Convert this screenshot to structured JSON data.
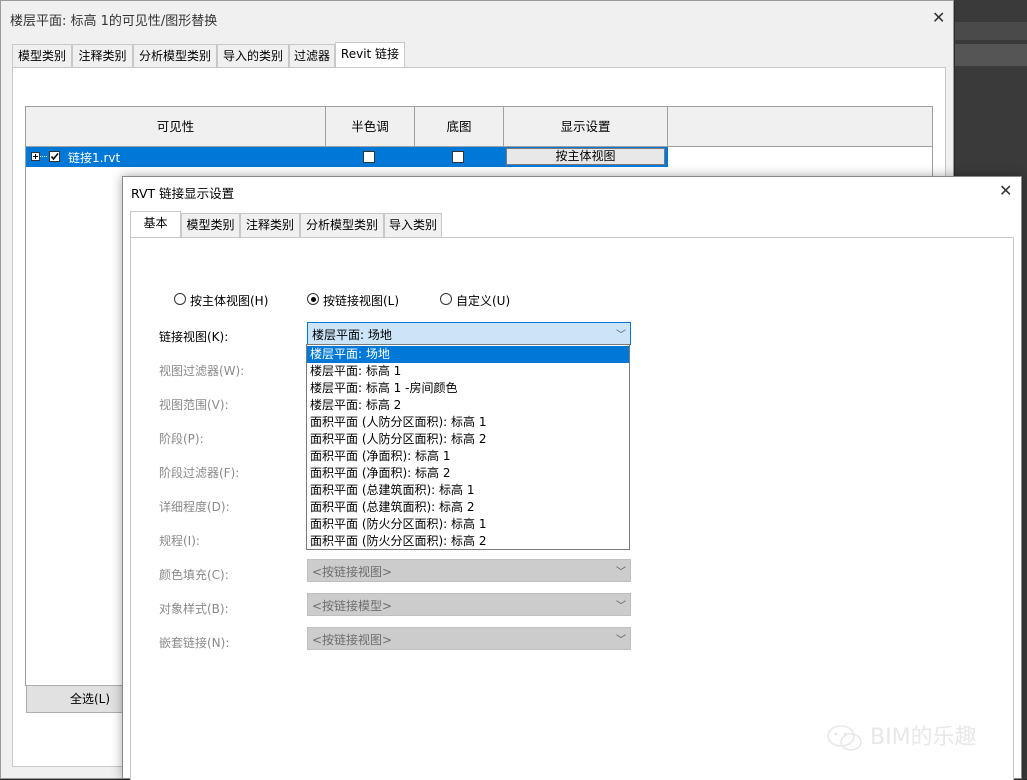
{
  "main_dialog": {
    "title": "楼层平面: 标高 1的可见性/图形替换",
    "tabs": [
      "模型类别",
      "注释类别",
      "分析模型类别",
      "导入的类别",
      "过滤器",
      "Revit 链接"
    ],
    "active_tab": "Revit 链接",
    "columns": [
      "可见性",
      "半色调",
      "底图",
      "显示设置"
    ],
    "rows": [
      {
        "name": "链接1.rvt",
        "visible": true,
        "halftone": false,
        "underlay": false,
        "display_setting": "按主体视图"
      }
    ],
    "select_all_label": "全选(L)"
  },
  "link_dialog": {
    "title": "RVT 链接显示设置",
    "tabs": [
      "基本",
      "模型类别",
      "注释类别",
      "分析模型类别",
      "导入类别"
    ],
    "active_tab": "基本",
    "radios": [
      {
        "label": "按主体视图(H)",
        "checked": false
      },
      {
        "label": "按链接视图(L)",
        "checked": true
      },
      {
        "label": "自定义(U)",
        "checked": false
      }
    ],
    "fields": [
      {
        "label": "链接视图(K):",
        "value": "楼层平面: 场地",
        "enabled": true
      },
      {
        "label": "视图过滤器(W):",
        "value": "",
        "enabled": false
      },
      {
        "label": "视图范围(V):",
        "value": "",
        "enabled": false
      },
      {
        "label": "阶段(P):",
        "value": "",
        "enabled": false
      },
      {
        "label": "阶段过滤器(F):",
        "value": "",
        "enabled": false
      },
      {
        "label": "详细程度(D):",
        "value": "",
        "enabled": false
      },
      {
        "label": "规程(I):",
        "value": "",
        "enabled": false
      },
      {
        "label": "颜色填充(C):",
        "value": "<按链接视图>",
        "enabled": false
      },
      {
        "label": "对象样式(B):",
        "value": "<按链接模型>",
        "enabled": false
      },
      {
        "label": "嵌套链接(N):",
        "value": "<按链接视图>",
        "enabled": false
      }
    ],
    "dropdown_options": [
      "楼层平面: 场地",
      "楼层平面: 标高 1",
      "楼层平面: 标高 1 -房间颜色",
      "楼层平面: 标高 2",
      "面积平面 (人防分区面积): 标高 1",
      "面积平面 (人防分区面积): 标高 2",
      "面积平面 (净面积): 标高 1",
      "面积平面 (净面积): 标高 2",
      "面积平面 (总建筑面积): 标高 1",
      "面积平面 (总建筑面积): 标高 2",
      "面积平面 (防火分区面积): 标高 1",
      "面积平面 (防火分区面积): 标高 2"
    ],
    "selected_option": "楼层平面: 场地"
  },
  "watermark": "BIM的乐趣",
  "icons": {
    "close": "close-icon",
    "dropdown": "chevron-down-icon",
    "expand": "expand-plus-icon",
    "wechat": "wechat-icon"
  },
  "colors": {
    "selection": "#0078d7",
    "selection_light": "#cce4f7"
  }
}
